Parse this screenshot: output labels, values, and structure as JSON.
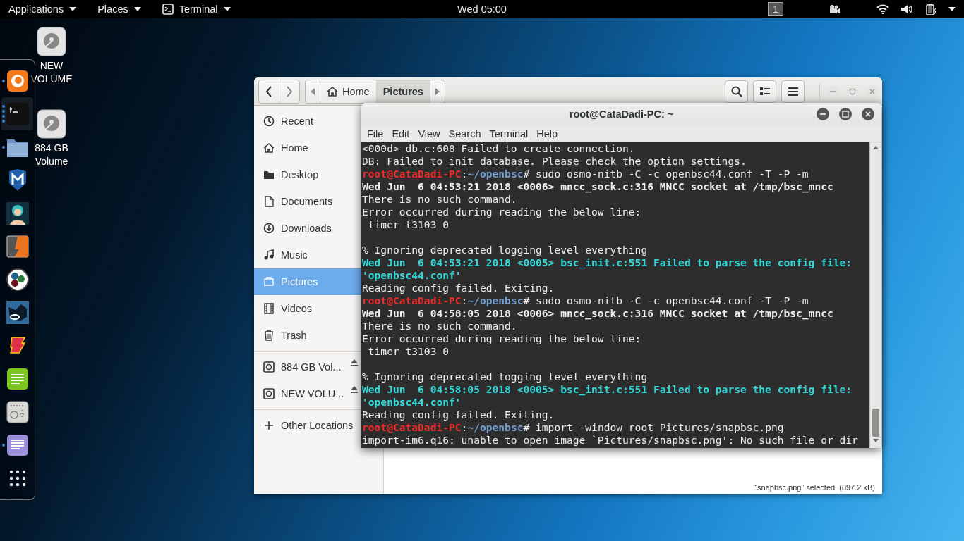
{
  "top_bar": {
    "menus": [
      {
        "label": "Applications",
        "kind": "menu"
      },
      {
        "label": "Places",
        "kind": "menu"
      },
      {
        "label": "Terminal",
        "kind": "app"
      }
    ],
    "clock": "Wed 05:00",
    "workspace": "1"
  },
  "desktop_icons": [
    {
      "label": "NEW VOLUME"
    },
    {
      "label": "884 GB Volume"
    }
  ],
  "dock": {
    "items": [
      {
        "kind": "browser",
        "running": true,
        "several_windows": false,
        "selected": false
      },
      {
        "kind": "terminal",
        "running": true,
        "several_windows": true,
        "selected": true
      },
      {
        "kind": "files",
        "running": true,
        "several_windows": false,
        "selected": false
      },
      {
        "kind": "shield",
        "running": false,
        "selected": false
      },
      {
        "kind": "figure",
        "running": false,
        "selected": false
      },
      {
        "kind": "bolt",
        "running": false,
        "selected": false
      },
      {
        "kind": "dots",
        "running": false,
        "selected": false
      },
      {
        "kind": "bull",
        "running": false,
        "selected": false
      },
      {
        "kind": "flame",
        "running": false,
        "selected": false
      },
      {
        "kind": "notes",
        "running": false,
        "selected": false
      },
      {
        "kind": "radio",
        "running": false,
        "selected": false
      },
      {
        "kind": "editor",
        "running": true,
        "several_windows": false,
        "selected": false
      },
      {
        "kind": "grid",
        "running": false,
        "selected": false
      }
    ]
  },
  "file_manager": {
    "path": [
      {
        "label": "Home",
        "kind": "home",
        "selected": false
      },
      {
        "label": "Pictures",
        "kind": "folder",
        "selected": true
      }
    ],
    "sidebar": {
      "sections": [
        {
          "items": [
            {
              "label": "Recent",
              "kind": "recent",
              "selected": false
            },
            {
              "label": "Home",
              "kind": "home",
              "selected": false
            },
            {
              "label": "Desktop",
              "kind": "desktop",
              "selected": false
            },
            {
              "label": "Documents",
              "kind": "documents",
              "selected": false
            },
            {
              "label": "Downloads",
              "kind": "downloads",
              "selected": false
            },
            {
              "label": "Music",
              "kind": "music",
              "selected": false
            },
            {
              "label": "Pictures",
              "kind": "pictures",
              "selected": true
            },
            {
              "label": "Videos",
              "kind": "videos",
              "selected": false
            },
            {
              "label": "Trash",
              "kind": "trash",
              "selected": false
            }
          ]
        },
        {
          "items": [
            {
              "label": "884 GB Vol...",
              "kind": "volume",
              "selected": false
            },
            {
              "label": "NEW VOLU...",
              "kind": "volume",
              "selected": false
            }
          ]
        },
        {
          "items": [
            {
              "label": "Other Locations",
              "kind": "other",
              "selected": false
            }
          ]
        }
      ]
    },
    "status": "“snapbsc.png” selected  (897.2 kB)"
  },
  "terminal": {
    "title": "root@CataDadi-PC: ~",
    "menu": [
      "File",
      "Edit",
      "View",
      "Search",
      "Terminal",
      "Help"
    ],
    "lines": [
      {
        "kind": "plain",
        "text": "<000d> db.c:608 Failed to create connection."
      },
      {
        "kind": "plain",
        "text": "DB: Failed to init database. Please check the option settings."
      },
      {
        "kind": "prompt",
        "user": "root@CataDadi-PC",
        "separator": ":",
        "path": "~/openbsc",
        "command": "# sudo osmo-nitb -C -c openbsc44.conf -T -P -m"
      },
      {
        "kind": "bold",
        "text": "Wed Jun  6 04:53:21 2018 <0006> mncc_sock.c:316 MNCC socket at /tmp/bsc_mncc"
      },
      {
        "kind": "plain",
        "text": "There is no such command."
      },
      {
        "kind": "plain",
        "text": "Error occurred during reading the below line:"
      },
      {
        "kind": "plain",
        "text": " timer t3103 0"
      },
      {
        "kind": "blank"
      },
      {
        "kind": "plain",
        "text": "% Ignoring deprecated logging level everything"
      },
      {
        "kind": "notice",
        "text": "Wed Jun  6 04:53:21 2018 <0005> bsc_init.c:551 Failed to parse the config file:"
      },
      {
        "kind": "notice",
        "text": "'openbsc44.conf'"
      },
      {
        "kind": "plain",
        "text": "Reading config failed. Exiting."
      },
      {
        "kind": "prompt",
        "user": "root@CataDadi-PC",
        "separator": ":",
        "path": "~/openbsc",
        "command": "# sudo osmo-nitb -C -c openbsc44.conf -T -P -m"
      },
      {
        "kind": "bold",
        "text": "Wed Jun  6 04:58:05 2018 <0006> mncc_sock.c:316 MNCC socket at /tmp/bsc_mncc"
      },
      {
        "kind": "plain",
        "text": "There is no such command."
      },
      {
        "kind": "plain",
        "text": "Error occurred during reading the below line:"
      },
      {
        "kind": "plain",
        "text": " timer t3103 0"
      },
      {
        "kind": "blank"
      },
      {
        "kind": "plain",
        "text": "% Ignoring deprecated logging level everything"
      },
      {
        "kind": "notice",
        "text": "Wed Jun  6 04:58:05 2018 <0005> bsc_init.c:551 Failed to parse the config file:"
      },
      {
        "kind": "notice",
        "text": "'openbsc44.conf'"
      },
      {
        "kind": "plain",
        "text": "Reading config failed. Exiting."
      },
      {
        "kind": "prompt",
        "user": "root@CataDadi-PC",
        "separator": ":",
        "path": "~/openbsc",
        "command": "# import -window root Pictures/snapbsc.png"
      },
      {
        "kind": "plain",
        "text": "import-im6.q16: unable to open image `Pictures/snapbsc.png': No such file or dir"
      }
    ]
  }
}
